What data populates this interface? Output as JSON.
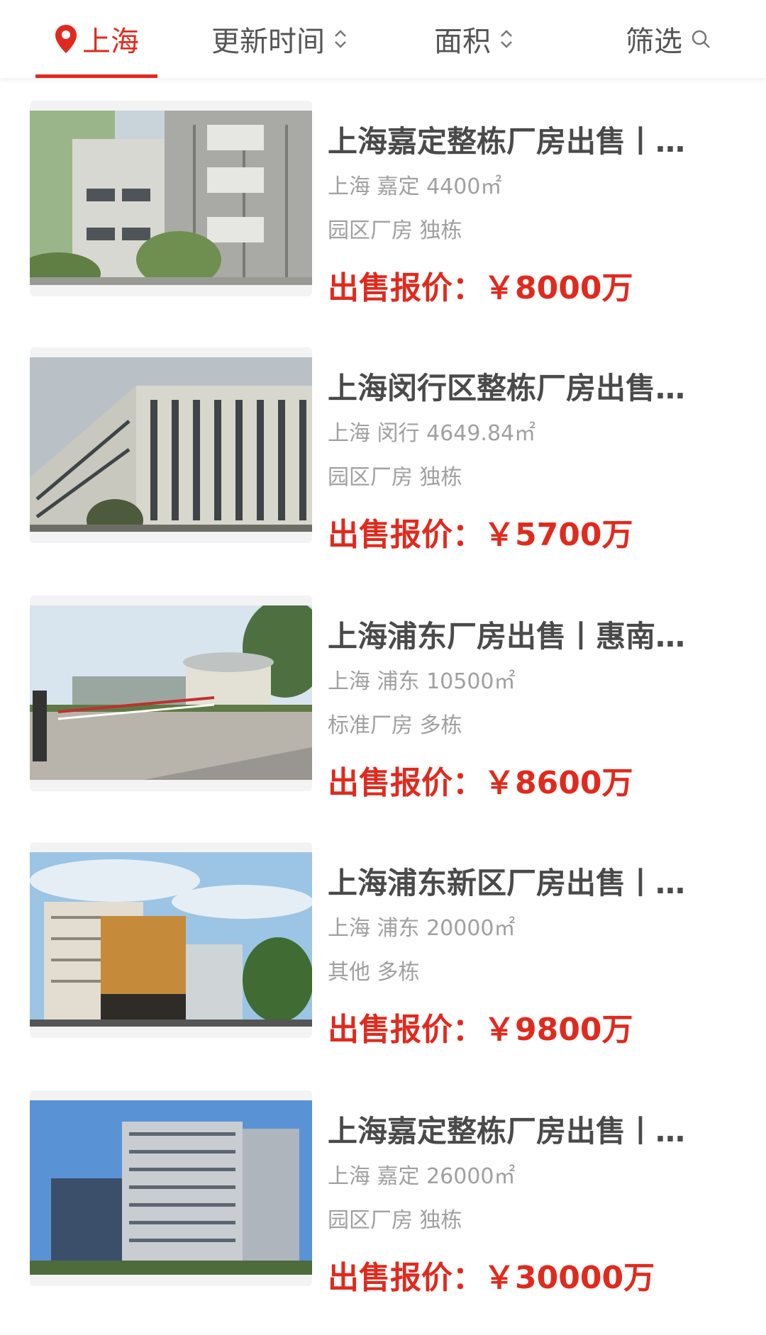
{
  "header": {
    "city_label": "上海",
    "update_label": "更新时间",
    "area_label": "面积",
    "filter_label": "筛选"
  },
  "colors": {
    "accent": "#e02a1e"
  },
  "listings": [
    {
      "title": "上海嘉定整栋厂房出售丨…",
      "location": "上海 嘉定 4400㎡",
      "tags": "园区厂房 独栋",
      "price_label": "出售报价：",
      "price": "￥8000万"
    },
    {
      "title": "上海闵行区整栋厂房出售…",
      "location": "上海 闵行 4649.84㎡",
      "tags": "园区厂房 独栋",
      "price_label": "出售报价：",
      "price": "￥5700万"
    },
    {
      "title": "上海浦东厂房出售丨惠南…",
      "location": "上海 浦东 10500㎡",
      "tags": "标准厂房 多栋",
      "price_label": "出售报价：",
      "price": "￥8600万"
    },
    {
      "title": "上海浦东新区厂房出售丨…",
      "location": "上海 浦东 20000㎡",
      "tags": "其他 多栋",
      "price_label": "出售报价：",
      "price": "￥9800万"
    },
    {
      "title": "上海嘉定整栋厂房出售丨…",
      "location": "上海 嘉定 26000㎡",
      "tags": "园区厂房 独栋",
      "price_label": "出售报价：",
      "price": "￥30000万"
    }
  ]
}
